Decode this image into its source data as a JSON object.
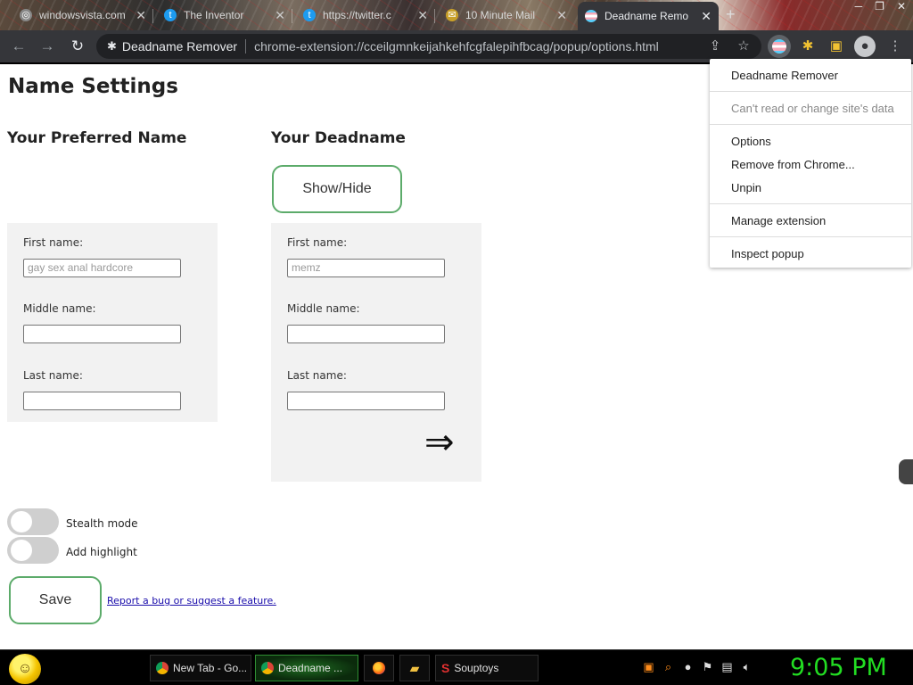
{
  "browser": {
    "tabs": [
      {
        "title": "windowsvista.com",
        "active": false
      },
      {
        "title": "The Inventor",
        "active": false
      },
      {
        "title": "https://twitter.c",
        "active": false
      },
      {
        "title": "10 Minute Mail",
        "active": false
      },
      {
        "title": "Deadname Remo",
        "active": true
      }
    ],
    "omnibox": {
      "site_name": "Deadname Remover",
      "url": "chrome-extension://cceilgmnkeijahkehfcgfalepihfbcag/popup/options.html"
    },
    "icons": {
      "back": "arrow-left-icon",
      "forward": "arrow-right-icon",
      "reload": "reload-icon",
      "share": "share-icon",
      "bookmark": "star-icon",
      "extension": "trans-flag-icon",
      "extensions_menu": "puzzle-icon",
      "sidepanel": "side-panel-icon",
      "profile": "profile-icon",
      "menu": "kebab-menu-icon"
    }
  },
  "page": {
    "title": "Name Settings",
    "preferred": {
      "heading": "Your Preferred Name",
      "first_label": "First name:",
      "first_placeholder": "gay sex anal hardcore",
      "middle_label": "Middle name:",
      "middle_value": "",
      "last_label": "Last name:",
      "last_value": ""
    },
    "deadname": {
      "heading": "Your Deadname",
      "show_hide_label": "Show/Hide",
      "first_label": "First name:",
      "first_placeholder": "memz",
      "middle_label": "Middle name:",
      "middle_value": "",
      "last_label": "Last name:",
      "last_value": "",
      "arrow": "⇒"
    },
    "toggles": [
      {
        "label": "Stealth mode",
        "on": false
      },
      {
        "label": "Add highlight",
        "on": false
      }
    ],
    "save_label": "Save",
    "report_link": "Report a bug or suggest a feature."
  },
  "extension_menu": {
    "title": "Deadname Remover",
    "permission": "Can't read or change site's data",
    "items": [
      "Options",
      "Remove from Chrome...",
      "Unpin"
    ],
    "manage": "Manage extension",
    "inspect": "Inspect popup"
  },
  "taskbar": {
    "tasks": [
      {
        "label": "New Tab - Go...",
        "active": false
      },
      {
        "label": "Deadname ...",
        "active": true
      },
      {
        "label": "",
        "icon": "firefox-icon"
      },
      {
        "label": "",
        "icon": "folder-icon"
      },
      {
        "label": "Souptoys",
        "active": false
      }
    ],
    "clock": "9:05 PM"
  },
  "colors": {
    "accent_green": "#5cab6a",
    "clock_green": "#22dd22",
    "toolbar_dark": "#35363a"
  }
}
